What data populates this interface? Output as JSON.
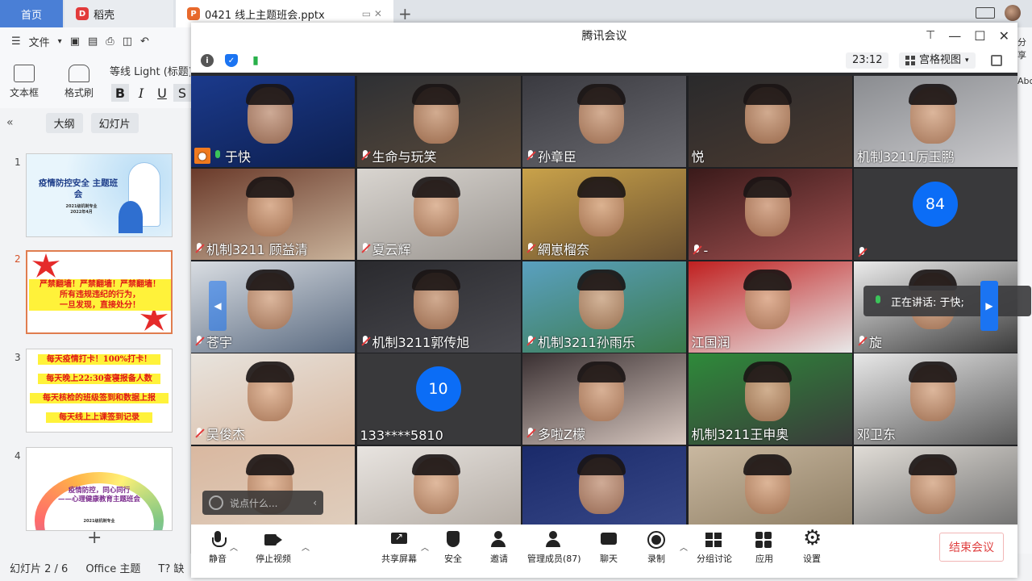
{
  "outer": {
    "tabs": {
      "home": "首页",
      "daoke": "稻壳",
      "document": "0421 线上主题班会.pptx"
    },
    "menu": {
      "file": "文件"
    },
    "tools": {
      "textbox": "文本框",
      "format_painter": "格式刷"
    },
    "font_name": "等线 Light (标题)",
    "format_buttons": [
      "B",
      "I",
      "U",
      "S"
    ],
    "panel_tabs": {
      "outline": "大纲",
      "slides": "幻灯片"
    },
    "right_strip": {
      "share": "分享",
      "abc": "Abc"
    },
    "slides": [
      {
        "num": "1",
        "title": "疫情防控安全\n主题班会",
        "sub": "2021级机制专业\n2022年4月"
      },
      {
        "num": "2",
        "title": "严禁翻墙！严禁翻墙！严禁翻墙！\n所有违规违纪的行为，\n一旦发现，直接处分！"
      },
      {
        "num": "3",
        "lines": [
          "每天疫情打卡！100%打卡！",
          "每天晚上22:30查寝报备人数",
          "每天核检的班级签到和数据上报",
          "每天线上上课签到记录"
        ]
      },
      {
        "num": "4",
        "title": "疫情防控，同心同行\n——心理健康教育主题班会",
        "sub": "2021级机制专业"
      }
    ],
    "status": {
      "slide_info": "幻灯片 2 / 6",
      "theme": "Office 主题",
      "missing_font": "缺"
    }
  },
  "meeting": {
    "title": "腾讯会议",
    "time": "23:12",
    "view_mode": "宫格视图",
    "speaking_text": "正在讲话: 于快;",
    "chat_placeholder": "说点什么...",
    "participants": [
      {
        "name": "于快",
        "mic": "on",
        "host": true
      },
      {
        "name": "生命与玩笑",
        "mic": "off"
      },
      {
        "name": "孙章臣",
        "mic": "off"
      },
      {
        "name": "悦",
        "mic": "none"
      },
      {
        "name": "机制3211厉玉鹏",
        "mic": "none"
      },
      {
        "name": "机制3211 顾益清",
        "mic": "off"
      },
      {
        "name": "夏云辉",
        "mic": "off"
      },
      {
        "name": "網崽榴奈",
        "mic": "off"
      },
      {
        "name": "-",
        "mic": "off"
      },
      {
        "name": "",
        "mic": "off",
        "bubble": "84"
      },
      {
        "name": "苍宇",
        "mic": "off"
      },
      {
        "name": "机制3211郭传旭",
        "mic": "off"
      },
      {
        "name": "机制3211孙雨乐",
        "mic": "off"
      },
      {
        "name": "江国润",
        "mic": "none"
      },
      {
        "name": "旋",
        "mic": "off"
      },
      {
        "name": "吴俊杰",
        "mic": "off"
      },
      {
        "name": "133****5810",
        "mic": "none",
        "bubble": "10"
      },
      {
        "name": "多啦Z檬",
        "mic": "off"
      },
      {
        "name": "机制3211王申奥",
        "mic": "none"
      },
      {
        "name": "邓卫东",
        "mic": "none"
      },
      {
        "name": "",
        "mic": "none"
      },
      {
        "name": "",
        "mic": "none"
      },
      {
        "name": "",
        "mic": "none"
      },
      {
        "name": "",
        "mic": "none"
      },
      {
        "name": "",
        "mic": "none"
      }
    ],
    "toolbar": {
      "mute": "静音",
      "stop_video": "停止视频",
      "share_screen": "共享屏幕",
      "security": "安全",
      "invite": "邀请",
      "manage_members": "管理成员(87)",
      "chat": "聊天",
      "record": "录制",
      "breakout": "分组讨论",
      "apps": "应用",
      "settings": "设置",
      "end_meeting": "结束会议"
    }
  }
}
